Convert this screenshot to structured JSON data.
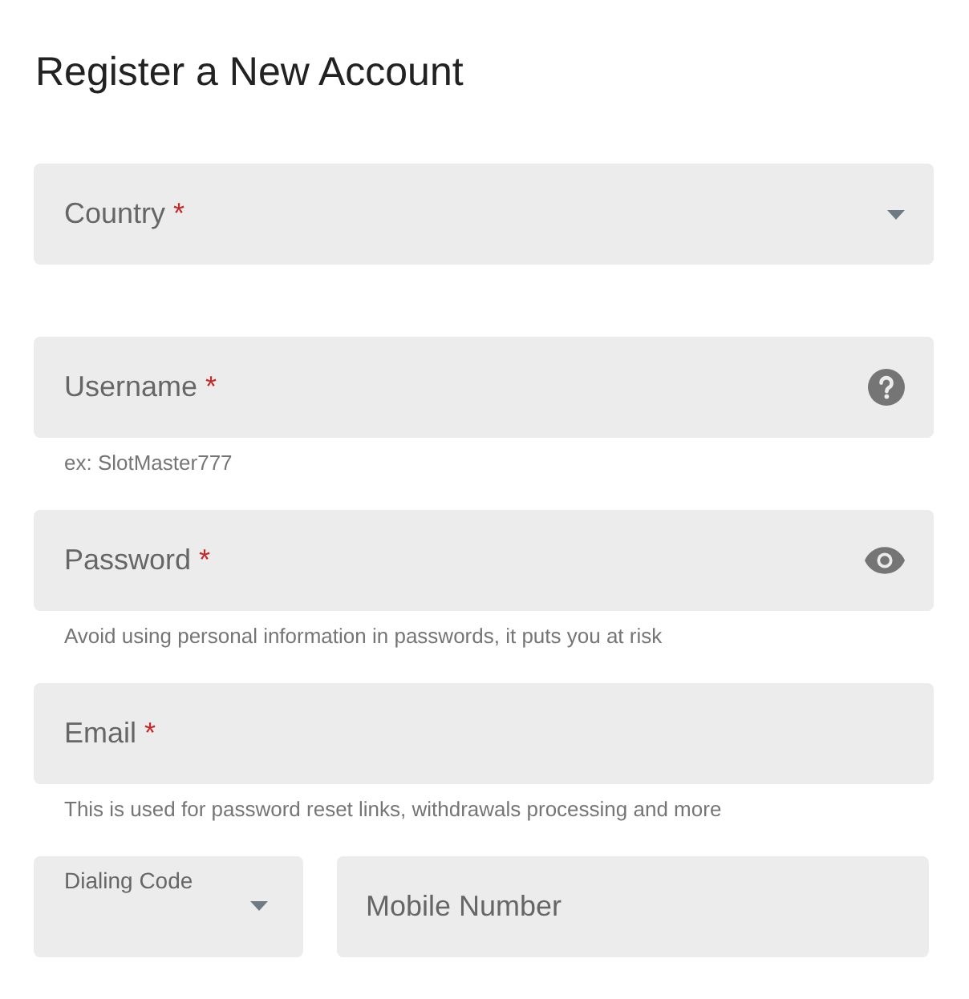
{
  "title": "Register a New Account",
  "fields": [
    {
      "kind": "select",
      "label": "Country",
      "required_mark": "*"
    },
    {
      "kind": "help",
      "label": "Username",
      "required_mark": "*",
      "hint": "ex: SlotMaster777"
    },
    {
      "kind": "password",
      "label": "Password",
      "required_mark": "*",
      "hint": "Avoid using personal information in passwords, it puts you at risk"
    },
    {
      "kind": "plain",
      "label": "Email",
      "required_mark": "*",
      "hint": "This is used for password reset links, withdrawals processing and more"
    }
  ],
  "phone": {
    "dialing_code": {
      "label": "Dialing Code"
    },
    "mobile": {
      "placeholder": "Mobile Number"
    }
  }
}
